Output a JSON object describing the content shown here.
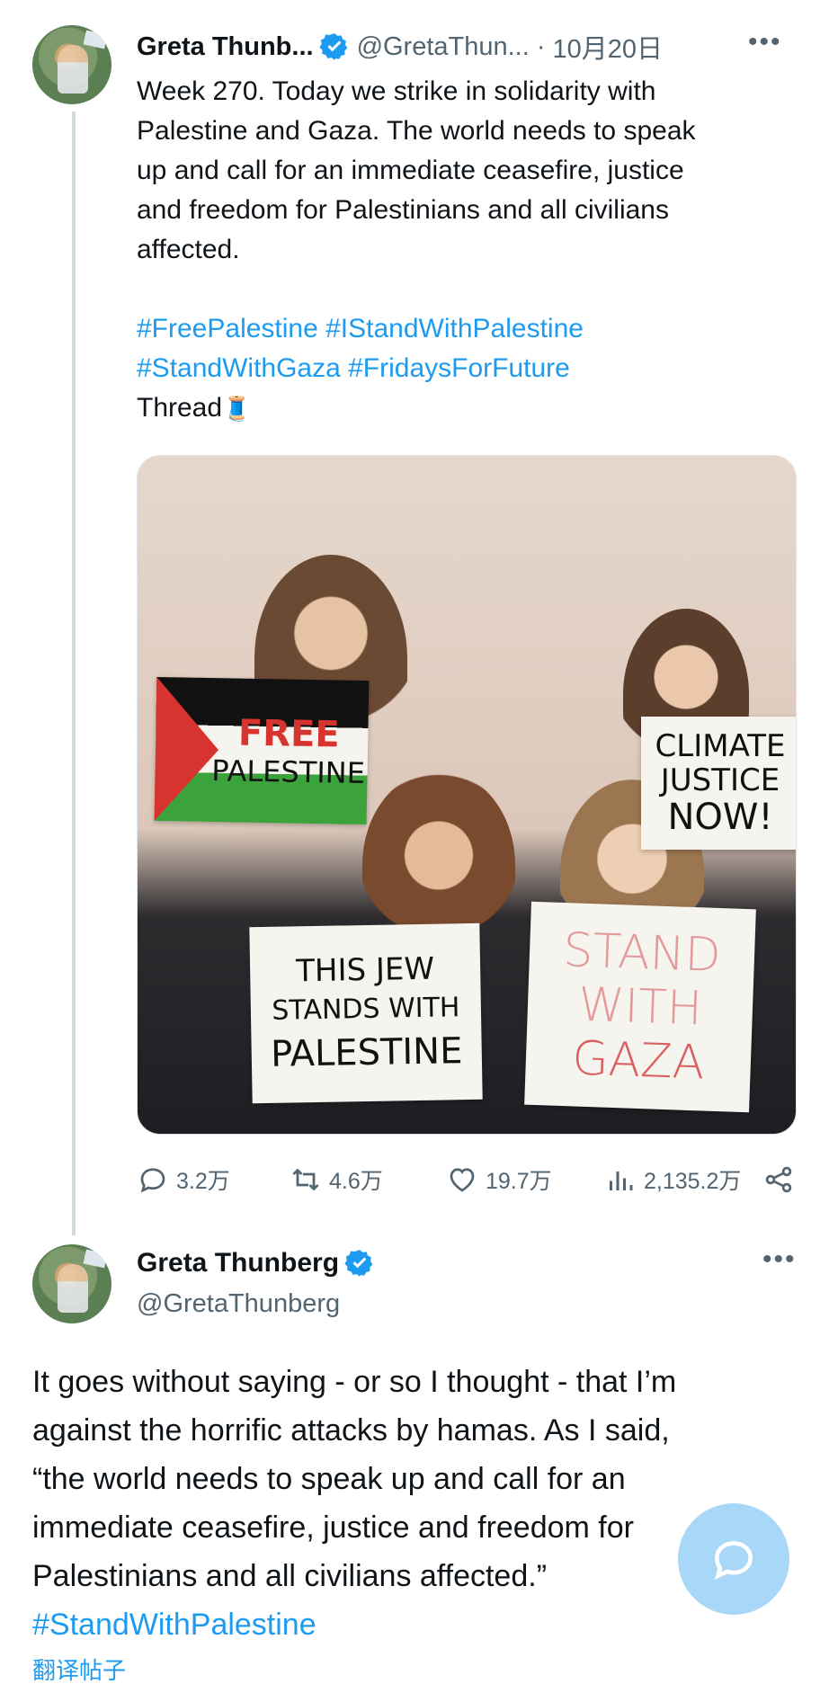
{
  "tweets": [
    {
      "author_name": "Greta Thunb...",
      "author_handle": "@GretaThun...",
      "time": "10月20日",
      "body_lines": [
        "Week 270. Today we strike in solidarity with",
        "Palestine and Gaza. The world needs to speak",
        "up and call for an immediate ceasefire, justice",
        "and freedom for Palestinians and all civilians",
        "affected."
      ],
      "hashtags_line1": "#FreePalestine #IStandWithPalestine",
      "hashtags_line2": "#StandWithGaza #FridaysForFuture",
      "thread_label": "Thread",
      "thread_emoji": "🧵",
      "photo_signs": {
        "sign1_line1": "FREE",
        "sign1_line2": "PALESTINE",
        "sign2_line1": "CLIMATE",
        "sign2_line2": "JUSTICE",
        "sign2_line3": "NOW!",
        "sign3_line1": "THIS JEW",
        "sign3_line2": "STANDS WITH",
        "sign3_line3": "PALESTINE",
        "sign4_line1": "STAND",
        "sign4_line2": "WITH",
        "sign4_line3": "GAZA"
      },
      "stats": {
        "replies": "3.2万",
        "reposts": "4.6万",
        "likes": "19.7万",
        "views": "2,135.2万"
      }
    },
    {
      "author_name": "Greta Thunberg",
      "author_handle": "@GretaThunberg",
      "body_lines": [
        "It goes without saying - or so I thought - that I’m",
        "against the horrific attacks by hamas. As I said,",
        "“the world needs to speak up and call for an",
        "immediate ceasefire, justice and freedom for",
        "Palestinians and all civilians affected.”"
      ],
      "hashtag": "#StandWithPalestine",
      "translate_label": "翻译帖子"
    }
  ],
  "colors": {
    "accent": "#1d9bf0",
    "secondary_text": "#536471",
    "fab": "#a9d7f8"
  },
  "icons": [
    "verified-badge-icon",
    "more-icon",
    "reply-icon",
    "repost-icon",
    "like-icon",
    "views-icon",
    "share-icon",
    "compose-icon"
  ]
}
